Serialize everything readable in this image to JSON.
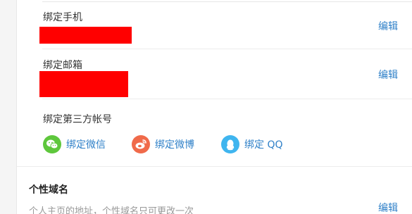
{
  "phone": {
    "label": "绑定手机",
    "edit_label": "编辑"
  },
  "email": {
    "label": "绑定邮箱",
    "edit_label": "编辑"
  },
  "third_party": {
    "label": "绑定第三方帐号",
    "items": [
      {
        "label": "绑定微信",
        "icon": "wechat-icon",
        "color": "#5ec73c"
      },
      {
        "label": "绑定微博",
        "icon": "weibo-icon",
        "color": "#f06a4a"
      },
      {
        "label": "绑定 QQ",
        "icon": "qq-icon",
        "color": "#3fb5ef"
      }
    ]
  },
  "domain": {
    "title": "个性域名",
    "hint": "个人主页的地址，个性域名只可更改一次",
    "edit_label": "编辑"
  },
  "colors": {
    "link": "#2f80c8",
    "redaction": "#ff0000"
  }
}
